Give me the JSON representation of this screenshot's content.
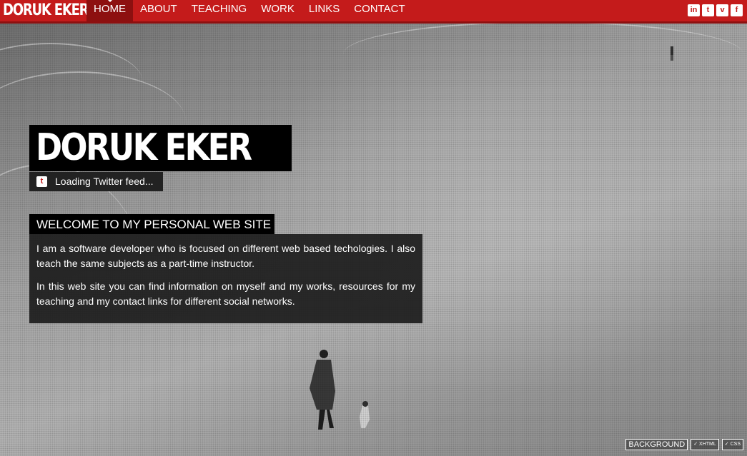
{
  "brand": "DORUK EKER",
  "nav": {
    "items": [
      {
        "label": "HOME",
        "active": true
      },
      {
        "label": "ABOUT"
      },
      {
        "label": "TEACHING"
      },
      {
        "label": "WORK"
      },
      {
        "label": "LINKS"
      },
      {
        "label": "CONTACT"
      }
    ]
  },
  "social": [
    {
      "icon": "linkedin-icon",
      "glyph": "in"
    },
    {
      "icon": "twitter-icon",
      "glyph": "t"
    },
    {
      "icon": "vimeo-icon",
      "glyph": "v"
    },
    {
      "icon": "facebook-icon",
      "glyph": "f"
    }
  ],
  "hero": {
    "title": "DORUK EKER",
    "twitter_status": "Loading Twitter feed..."
  },
  "welcome": {
    "heading": "WELCOME TO MY PERSONAL WEB SITE",
    "paragraphs": [
      "I am a software developer who is focused on different web based techologies. I also teach the same subjects as a part-time instructor.",
      "In this web site you can find information on myself and my works, resources for my teaching and my contact links for different social networks."
    ]
  },
  "footer": {
    "background_label": "BACKGROUND",
    "xhtml_label": "✓ XHTML",
    "css_label": "✓ CSS"
  },
  "colors": {
    "accent": "#c41b1b",
    "accent_dark": "#8d1010"
  }
}
